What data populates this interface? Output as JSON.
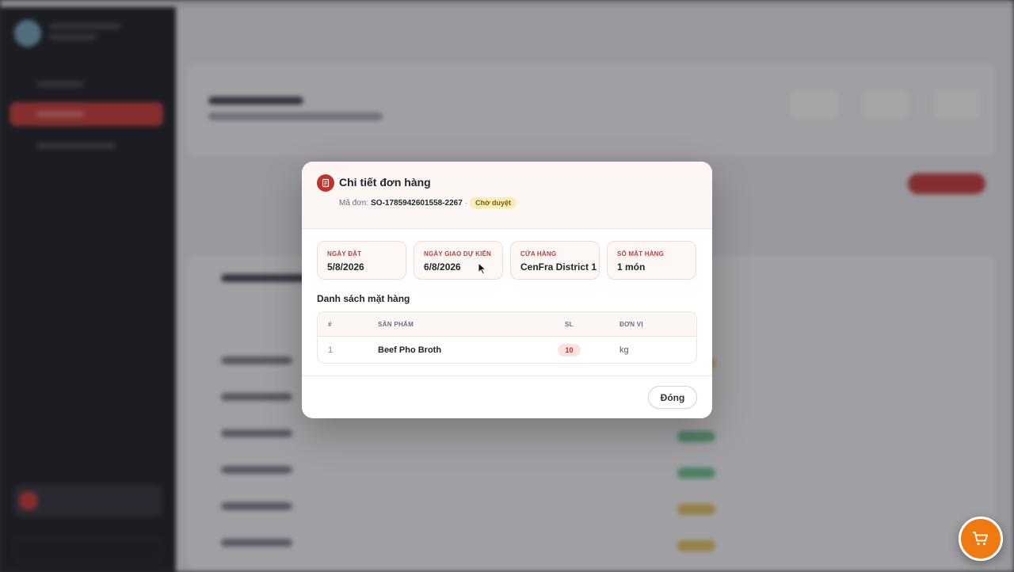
{
  "modal": {
    "title": "Chi tiết đơn hàng",
    "order_code_label": "Mã đơn:",
    "order_code": "SO-1785942601558-2267",
    "status_badge": "Chờ duyệt",
    "info": [
      {
        "label": "Ngày đặt",
        "value": "5/8/2026"
      },
      {
        "label": "Ngày giao dự kiến",
        "value": "6/8/2026"
      },
      {
        "label": "Cửa hàng",
        "value": "CenFra District 1"
      },
      {
        "label": "Số mặt hàng",
        "value": "1 món"
      }
    ],
    "items_title": "Danh sách mặt hàng",
    "table": {
      "headers": [
        "#",
        "Sản phẩm",
        "SL",
        "Đơn vị"
      ],
      "rows": [
        {
          "index": "1",
          "product": "Beef Pho Broth",
          "qty": "10",
          "unit": "kg"
        }
      ]
    },
    "close_label": "Đóng"
  },
  "colors": {
    "accent": "#c0332d",
    "badge_bg": "#fbeeb5",
    "cart": "#f07a12"
  },
  "icons": {
    "header": "receipt-icon",
    "cart": "cart-icon"
  }
}
